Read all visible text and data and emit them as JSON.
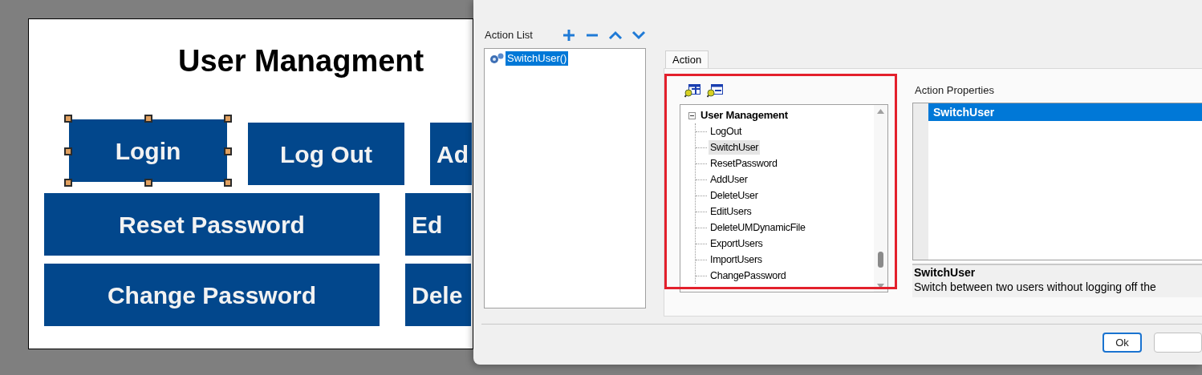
{
  "canvas": {
    "title": "User Managment",
    "button_rows": [
      [
        {
          "label": "Login",
          "selected": true
        },
        {
          "label": "Log Out",
          "selected": false
        },
        {
          "label": "Ad",
          "selected": false
        }
      ],
      [
        {
          "label": "Reset Password",
          "selected": false
        },
        {
          "label": "Ed",
          "selected": false
        }
      ],
      [
        {
          "label": "Change Password",
          "selected": false
        },
        {
          "label": "Dele",
          "selected": false
        }
      ]
    ]
  },
  "dialog": {
    "action_list": {
      "label": "Action List",
      "items": [
        {
          "label": "SwitchUser()",
          "selected": true
        }
      ]
    },
    "tabs": [
      {
        "label": "Action",
        "selected": true
      }
    ],
    "tree": [
      {
        "label": "User Management",
        "expanded": true,
        "children": [
          {
            "label": "LogOut",
            "selected": false
          },
          {
            "label": "SwitchUser",
            "selected": true
          },
          {
            "label": "ResetPassword",
            "selected": false
          },
          {
            "label": "AddUser",
            "selected": false
          },
          {
            "label": "DeleteUser",
            "selected": false
          },
          {
            "label": "EditUsers",
            "selected": false
          },
          {
            "label": "DeleteUMDynamicFile",
            "selected": false
          },
          {
            "label": "ExportUsers",
            "selected": false
          },
          {
            "label": "ImportUsers",
            "selected": false
          },
          {
            "label": "ChangePassword",
            "selected": false
          }
        ]
      }
    ],
    "properties": {
      "label": "Action Properties",
      "rows": [
        {
          "name": "SwitchUser",
          "selected": true
        }
      ],
      "description_title": "SwitchUser",
      "description": "Switch between two users without logging off the"
    },
    "buttons": [
      "Ok"
    ]
  }
}
